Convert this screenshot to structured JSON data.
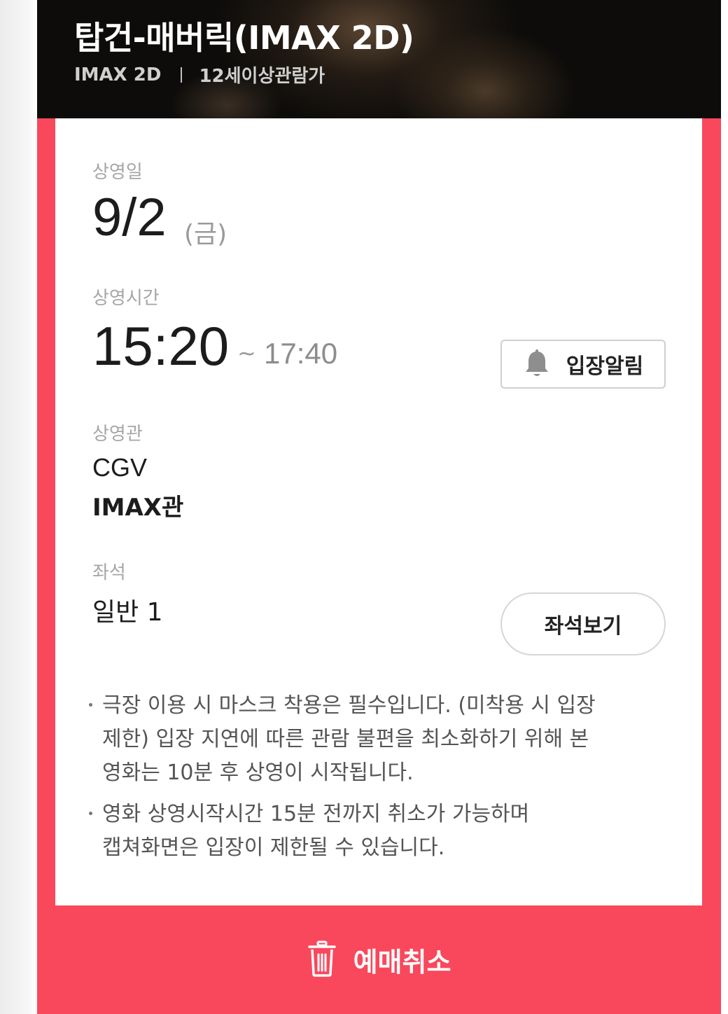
{
  "movie": {
    "title": "탑건-매버릭(IMAX 2D)",
    "format": "IMAX 2D",
    "rating": "12세이상관람가"
  },
  "schedule": {
    "date_label": "상영일",
    "date": "9/2",
    "day": "(금)",
    "time_label": "상영시간",
    "start_time": "15:20",
    "range_sep": "~",
    "end_time": "17:40",
    "notify_button": "입장알림"
  },
  "theater": {
    "label": "상영관",
    "cinema": "CGV",
    "hall": "IMAX관"
  },
  "seat": {
    "label": "좌석",
    "value": "일반 1",
    "view_button": "좌석보기"
  },
  "notices": [
    {
      "lines": [
        "극장 이용 시 마스크 착용은 필수입니다. (미착용 시 입장",
        "제한) 입장 지연에 따른 관람 불편을 최소화하기 위해 본",
        "영화는 10분 후 상영이 시작됩니다."
      ]
    },
    {
      "lines": [
        "영화 상영시작시간 15분 전까지 취소가 가능하며",
        "캡쳐화면은 입장이 제한될 수 있습니다."
      ]
    }
  ],
  "actions": {
    "cancel_label": "예매취소"
  },
  "colors": {
    "accent": "#f9485c",
    "header_bg": "#0d0c0a",
    "card_bg": "#ffffff"
  },
  "icons": {
    "notify": "bell-icon",
    "cancel": "trash-icon"
  }
}
